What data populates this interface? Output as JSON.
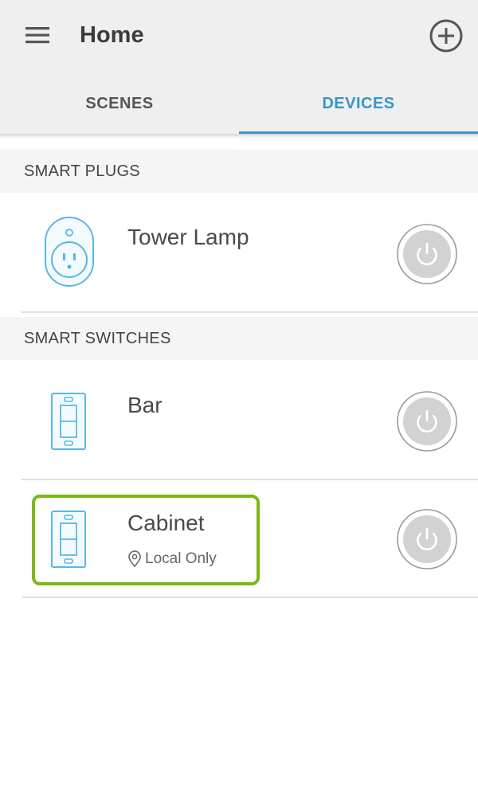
{
  "header": {
    "title": "Home"
  },
  "tabs": [
    {
      "label": "SCENES",
      "active": false
    },
    {
      "label": "DEVICES",
      "active": true
    }
  ],
  "sections": [
    {
      "title": "SMART PLUGS",
      "devices": [
        {
          "name": "Tower Lamp",
          "icon": "smart-plug-icon",
          "status": ""
        }
      ]
    },
    {
      "title": "SMART SWITCHES",
      "devices": [
        {
          "name": "Bar",
          "icon": "light-switch-icon",
          "status": ""
        },
        {
          "name": "Cabinet",
          "icon": "light-switch-icon",
          "status": "Local Only",
          "status_icon": "location-pin-icon",
          "highlighted": true
        }
      ]
    }
  ],
  "colors": {
    "accent": "#3b94cc",
    "highlight": "#7ab817",
    "appbar": "#efefef",
    "icon_blue": "#5bb7e2"
  }
}
